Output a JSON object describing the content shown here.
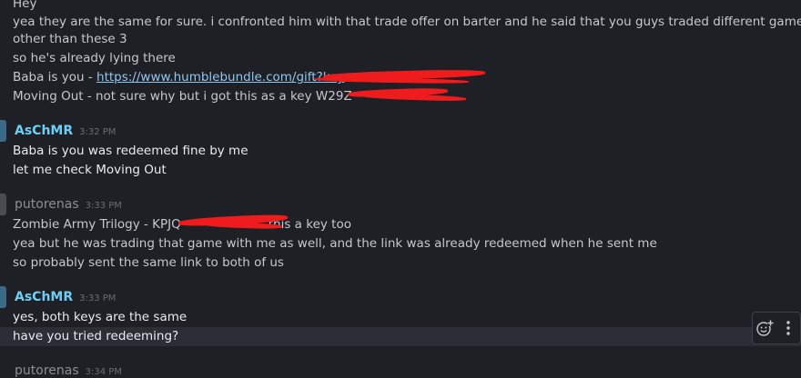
{
  "messages_top": {
    "line_hey": "Hey",
    "line1": "yea they are the same for sure. i confronted him with that trade offer on barter and he said that you guys traded different games",
    "line2": "other than these 3",
    "line3": "so he's already lying there",
    "line4_prefix": "Baba is you - ",
    "line4_link": "https://www.humblebundle.com/gift?key",
    "line5": "Moving Out - not sure why but i got this as a key W29Z"
  },
  "group1": {
    "author": "AsChMR",
    "time": "3:32 PM",
    "line1": "Baba is you was redeemed fine by me",
    "line2": "let me check Moving Out"
  },
  "group2": {
    "author": "putorenas",
    "time": "3:33 PM",
    "line1_prefix": "Zombie Army Trilogy - KPJQ",
    "line1_suffix": "this a key too",
    "line2": "yea but he was trading that game with me as well, and the link was already redeemed when he sent me",
    "line3": "so probably sent the same link to both of us"
  },
  "group3": {
    "author": "AsChMR",
    "time": "3:33 PM",
    "line1": "yes, both keys are the same",
    "line2": "have you tried redeeming?"
  },
  "group4": {
    "author": "putorenas",
    "time": "3:34 PM"
  },
  "toolbar": {
    "react_icon": "add-reaction-icon",
    "more_icon": "more-vertical-icon"
  },
  "colors": {
    "background": "#1e2025",
    "self_name": "#6dcff6",
    "other_name": "#8c8e92",
    "link": "#8ec7f2",
    "redaction": "#ee1c1c"
  }
}
